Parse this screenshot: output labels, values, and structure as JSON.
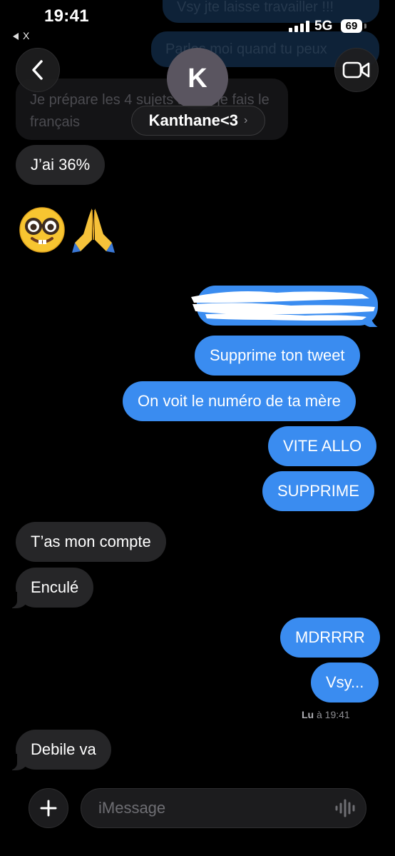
{
  "status_bar": {
    "time": "19:41",
    "back_app": "X",
    "network": "5G",
    "battery": "69"
  },
  "header": {
    "avatar_initial": "K",
    "contact_name": "Kanthane<3",
    "chevron": "›"
  },
  "faded_messages": [
    {
      "text": "Vsy jte laisse travailler !!!",
      "direction": "outgoing"
    },
    {
      "text": "Parles moi quand tu peux",
      "direction": "outgoing"
    },
    {
      "text": "Je prépare les 4 sujets après je fais le français",
      "direction": "incoming"
    }
  ],
  "messages": [
    {
      "id": "m1",
      "text": "J’ai 36%",
      "direction": "incoming"
    },
    {
      "id": "m2",
      "text": "🤓🙏",
      "direction": "incoming",
      "kind": "emoji"
    },
    {
      "id": "m3",
      "text": "",
      "direction": "outgoing",
      "kind": "redacted"
    },
    {
      "id": "m4",
      "text": "Supprime ton tweet",
      "direction": "outgoing"
    },
    {
      "id": "m5",
      "text": "On voit le numéro de ta mère",
      "direction": "outgoing"
    },
    {
      "id": "m6",
      "text": "VITE ALLO",
      "direction": "outgoing"
    },
    {
      "id": "m7",
      "text": "SUPPRIME",
      "direction": "outgoing"
    },
    {
      "id": "m8",
      "text": "T’as mon compte",
      "direction": "incoming"
    },
    {
      "id": "m9",
      "text": "Enculé",
      "direction": "incoming"
    },
    {
      "id": "m10",
      "text": "MDRRRR",
      "direction": "outgoing"
    },
    {
      "id": "m11",
      "text": "Vsy...",
      "direction": "outgoing"
    },
    {
      "id": "m12",
      "text": "Debile va",
      "direction": "incoming"
    }
  ],
  "read_receipt": {
    "label": "Lu",
    "time": "à 19:41"
  },
  "composer": {
    "placeholder": "iMessage"
  },
  "colors": {
    "outgoing_bubble": "#3a8cf0",
    "incoming_bubble": "#262628",
    "background": "#000000"
  },
  "icons": {
    "back": "chevron-left-icon",
    "video": "video-camera-icon",
    "plus": "plus-icon",
    "audio": "waveform-icon"
  }
}
